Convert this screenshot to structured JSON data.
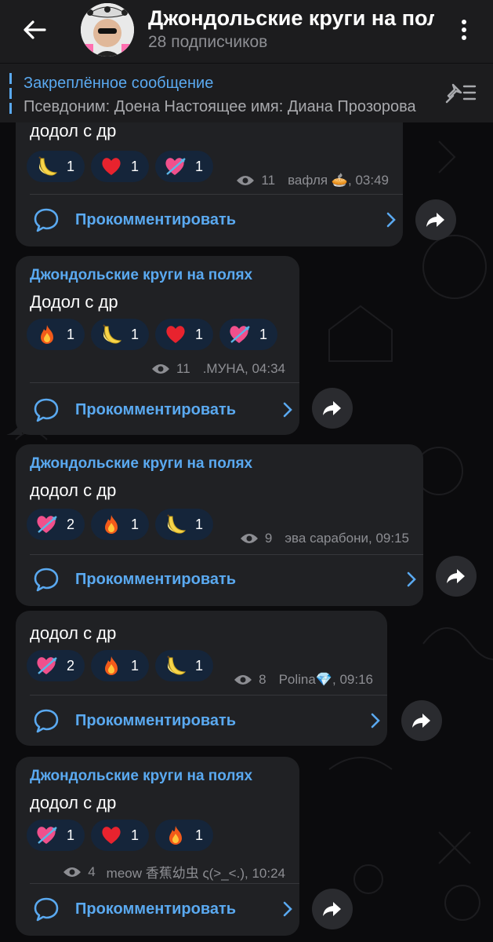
{
  "header": {
    "title": "Джондольские круги на полях",
    "subtitle": "28 подписчиков"
  },
  "pinned": {
    "title": "Закреплённое сообщение",
    "text": "Псевдоним: Доена Настоящее имя: Диана Прозорова"
  },
  "comment_label": "Прокомментировать",
  "colors": {
    "accent": "#5aa9f0",
    "bubble": "#202124",
    "header": "#1c1c1e",
    "reaction_bg": "#15253a",
    "muted": "#8d8e93"
  },
  "posts": [
    {
      "sender": "",
      "text": "додол с др",
      "reactions": [
        {
          "emoji": "banana",
          "count": "1"
        },
        {
          "emoji": "heart",
          "count": "1"
        },
        {
          "emoji": "heart-arrow",
          "count": "1"
        }
      ],
      "views": "11",
      "author_time": "вафля 🥧, 03:49"
    },
    {
      "sender": "Джондольские круги на полях",
      "text": "Додол  с др",
      "reactions": [
        {
          "emoji": "fire",
          "count": "1"
        },
        {
          "emoji": "banana",
          "count": "1"
        },
        {
          "emoji": "heart",
          "count": "1"
        },
        {
          "emoji": "heart-arrow",
          "count": "1"
        }
      ],
      "views": "11",
      "author_time": ".МУНА, 04:34"
    },
    {
      "sender": "Джондольские круги на полях",
      "text": "додол с др",
      "reactions": [
        {
          "emoji": "heart-arrow",
          "count": "2"
        },
        {
          "emoji": "fire",
          "count": "1"
        },
        {
          "emoji": "banana",
          "count": "1"
        }
      ],
      "views": "9",
      "author_time": "эва сарабони, 09:15"
    },
    {
      "sender": "",
      "text": "додол с др",
      "reactions": [
        {
          "emoji": "heart-arrow",
          "count": "2"
        },
        {
          "emoji": "fire",
          "count": "1"
        },
        {
          "emoji": "banana",
          "count": "1"
        }
      ],
      "views": "8",
      "author_time": "Polina💎, 09:16"
    },
    {
      "sender": "Джондольские круги на полях",
      "text": "додол с др",
      "reactions": [
        {
          "emoji": "heart-arrow",
          "count": "1"
        },
        {
          "emoji": "heart",
          "count": "1"
        },
        {
          "emoji": "fire",
          "count": "1"
        }
      ],
      "views": "4",
      "author_time": "meow 香蕉幼虫 ς(>_<.), 10:24"
    }
  ]
}
